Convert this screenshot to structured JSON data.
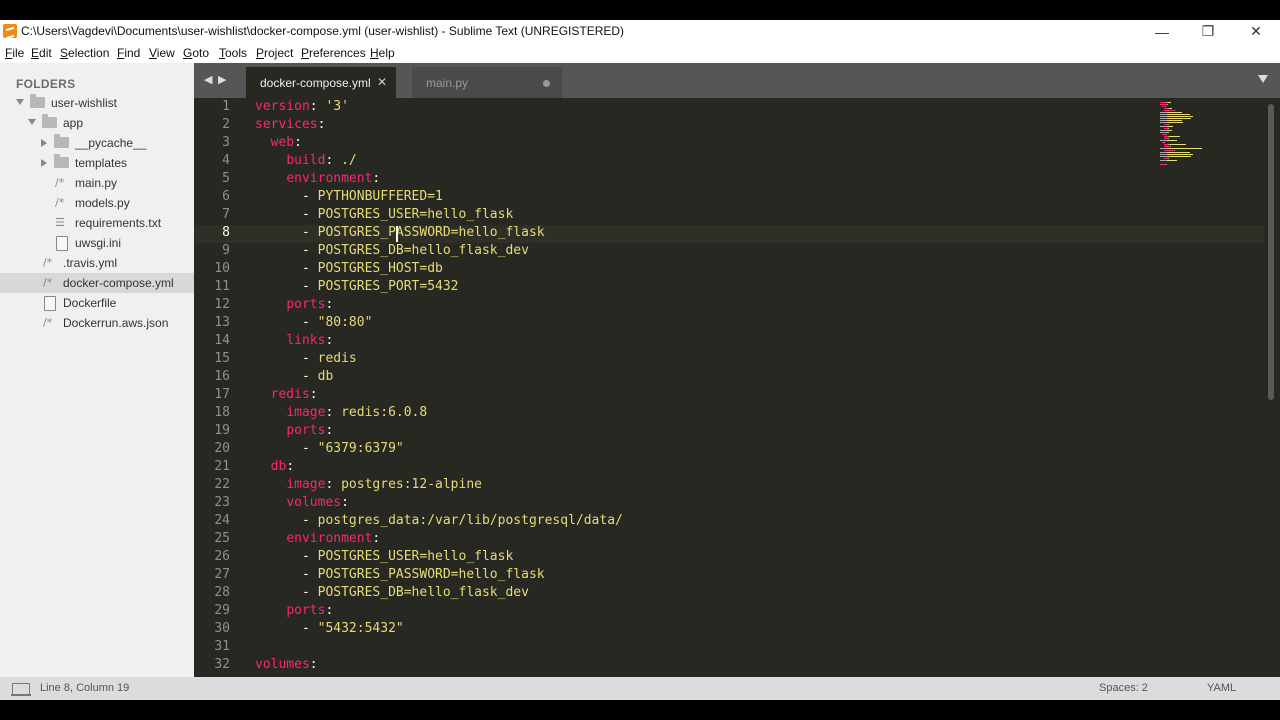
{
  "window": {
    "title": "C:\\Users\\Vagdevi\\Documents\\user-wishlist\\docker-compose.yml (user-wishlist) - Sublime Text (UNREGISTERED)",
    "minimize_glyph": "—",
    "maximize_glyph": "❐",
    "close_glyph": "✕"
  },
  "menu": [
    "File",
    "Edit",
    "Selection",
    "Find",
    "View",
    "Goto",
    "Tools",
    "Project",
    "Preferences",
    "Help"
  ],
  "sidebar": {
    "title": "FOLDERS",
    "items": [
      {
        "label": "user-wishlist",
        "kind": "folder",
        "expanded": true
      },
      {
        "label": "app",
        "kind": "folder",
        "expanded": true
      },
      {
        "label": "__pycache__",
        "kind": "folder",
        "expanded": false
      },
      {
        "label": "templates",
        "kind": "folder",
        "expanded": false
      },
      {
        "label": "main.py",
        "kind": "code-file"
      },
      {
        "label": "models.py",
        "kind": "code-file"
      },
      {
        "label": "requirements.txt",
        "kind": "text-file"
      },
      {
        "label": "uwsgi.ini",
        "kind": "plain-file"
      },
      {
        "label": ".travis.yml",
        "kind": "code-file"
      },
      {
        "label": "docker-compose.yml",
        "kind": "code-file",
        "selected": true
      },
      {
        "label": "Dockerfile",
        "kind": "plain-file"
      },
      {
        "label": "Dockerrun.aws.json",
        "kind": "code-file"
      }
    ]
  },
  "tabs": {
    "back_glyph": "◀",
    "forward_glyph": "▶",
    "items": [
      {
        "label": "docker-compose.yml",
        "active": true,
        "close_glyph": "✕"
      },
      {
        "label": "main.py",
        "active": false,
        "modified": true
      }
    ]
  },
  "editor": {
    "current_line": 8,
    "lines": [
      [
        {
          "t": "version",
          "c": "key"
        },
        {
          "t": ": "
        },
        {
          "t": "'3'",
          "c": "val"
        }
      ],
      [
        {
          "t": "services",
          "c": "key"
        },
        {
          "t": ":"
        }
      ],
      [
        {
          "t": "  "
        },
        {
          "t": "web",
          "c": "key"
        },
        {
          "t": ":"
        }
      ],
      [
        {
          "t": "    "
        },
        {
          "t": "build",
          "c": "key"
        },
        {
          "t": ": "
        },
        {
          "t": "./",
          "c": "val"
        }
      ],
      [
        {
          "t": "    "
        },
        {
          "t": "environment",
          "c": "key"
        },
        {
          "t": ":"
        }
      ],
      [
        {
          "t": "      - "
        },
        {
          "t": "PYTHONBUFFERED=1",
          "c": "val"
        }
      ],
      [
        {
          "t": "      - "
        },
        {
          "t": "POSTGRES_USER=hello_flask",
          "c": "val"
        }
      ],
      [
        {
          "t": "      - "
        },
        {
          "t": "POSTGRES_PASSWORD=hello_flask",
          "c": "val"
        }
      ],
      [
        {
          "t": "      - "
        },
        {
          "t": "POSTGRES_DB=hello_flask_dev",
          "c": "val"
        }
      ],
      [
        {
          "t": "      - "
        },
        {
          "t": "POSTGRES_HOST=db",
          "c": "val"
        }
      ],
      [
        {
          "t": "      - "
        },
        {
          "t": "POSTGRES_PORT=5432",
          "c": "val"
        }
      ],
      [
        {
          "t": "    "
        },
        {
          "t": "ports",
          "c": "key"
        },
        {
          "t": ":"
        }
      ],
      [
        {
          "t": "      - "
        },
        {
          "t": "\"80:80\"",
          "c": "val"
        }
      ],
      [
        {
          "t": "    "
        },
        {
          "t": "links",
          "c": "key"
        },
        {
          "t": ":"
        }
      ],
      [
        {
          "t": "      - "
        },
        {
          "t": "redis",
          "c": "val"
        }
      ],
      [
        {
          "t": "      - "
        },
        {
          "t": "db",
          "c": "val"
        }
      ],
      [
        {
          "t": "  "
        },
        {
          "t": "redis",
          "c": "key"
        },
        {
          "t": ":"
        }
      ],
      [
        {
          "t": "    "
        },
        {
          "t": "image",
          "c": "key"
        },
        {
          "t": ": "
        },
        {
          "t": "redis:6.0.8",
          "c": "val"
        }
      ],
      [
        {
          "t": "    "
        },
        {
          "t": "ports",
          "c": "key"
        },
        {
          "t": ":"
        }
      ],
      [
        {
          "t": "      - "
        },
        {
          "t": "\"6379:6379\"",
          "c": "val"
        }
      ],
      [
        {
          "t": "  "
        },
        {
          "t": "db",
          "c": "key"
        },
        {
          "t": ":"
        }
      ],
      [
        {
          "t": "    "
        },
        {
          "t": "image",
          "c": "key"
        },
        {
          "t": ": "
        },
        {
          "t": "postgres:12-alpine",
          "c": "val"
        }
      ],
      [
        {
          "t": "    "
        },
        {
          "t": "volumes",
          "c": "key"
        },
        {
          "t": ":"
        }
      ],
      [
        {
          "t": "      - "
        },
        {
          "t": "postgres_data:/var/lib/postgresql/data/",
          "c": "val"
        }
      ],
      [
        {
          "t": "    "
        },
        {
          "t": "environment",
          "c": "key"
        },
        {
          "t": ":"
        }
      ],
      [
        {
          "t": "      - "
        },
        {
          "t": "POSTGRES_USER=hello_flask",
          "c": "val"
        }
      ],
      [
        {
          "t": "      - "
        },
        {
          "t": "POSTGRES_PASSWORD=hello_flask",
          "c": "val"
        }
      ],
      [
        {
          "t": "      - "
        },
        {
          "t": "POSTGRES_DB=hello_flask_dev",
          "c": "val"
        }
      ],
      [
        {
          "t": "    "
        },
        {
          "t": "ports",
          "c": "key"
        },
        {
          "t": ":"
        }
      ],
      [
        {
          "t": "      - "
        },
        {
          "t": "\"5432:5432\"",
          "c": "val"
        }
      ],
      [],
      [
        {
          "t": "volumes",
          "c": "key"
        },
        {
          "t": ":"
        }
      ]
    ]
  },
  "status": {
    "position": "Line 8, Column 19",
    "indentation": "Spaces: 2",
    "syntax": "YAML"
  },
  "colors": {
    "editor_bg": "#272822",
    "key": "#f92672",
    "value": "#e6db74",
    "modified_marker": "#a6d84c"
  }
}
